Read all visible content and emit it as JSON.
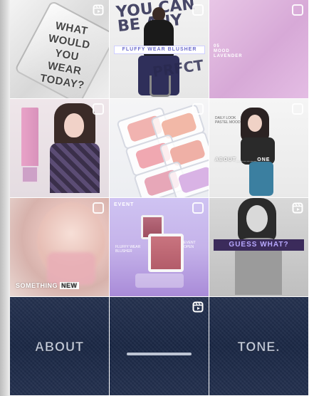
{
  "grid": {
    "tiles": [
      {
        "id": 1,
        "text_lines": [
          "WHAT",
          "WOULD",
          "YOU",
          "WEAR",
          "TODAY?"
        ],
        "badge": "reel-icon"
      },
      {
        "id": 2,
        "graffiti": "YOU CAN BE ANY",
        "graffiti2": "PRFCT",
        "band": "FLUFFY WEAR BLUSHER",
        "badge": "multiple-icon"
      },
      {
        "id": 3,
        "label_lines": [
          "MOOD",
          "LAVENDER"
        ],
        "label_prefix": "05",
        "badge": "multiple-icon"
      },
      {
        "id": 4,
        "badge": "multiple-icon"
      },
      {
        "id": 5,
        "badge": "multiple-icon"
      },
      {
        "id": 6,
        "about": "ABOUT______ONE",
        "small": "DAILY LOOK\nPASTEL MOOD",
        "badge": "multiple-icon"
      },
      {
        "id": 7,
        "caption_left": "SOMETHING",
        "caption_right": "NEW",
        "badge": "multiple-icon"
      },
      {
        "id": 8,
        "event": "EVENT",
        "tiny_left": "FLUFFY WEAR\nBLUSHER",
        "tiny_right": "EVENT\nOPEN",
        "badge": "multiple-icon"
      },
      {
        "id": 9,
        "banner": "GUESS WHAT?",
        "badge": "reel-icon"
      },
      {
        "id": 10,
        "word": "ABOUT"
      },
      {
        "id": 11,
        "badge": "reel-icon"
      },
      {
        "id": 12,
        "word": "TONE."
      }
    ]
  }
}
